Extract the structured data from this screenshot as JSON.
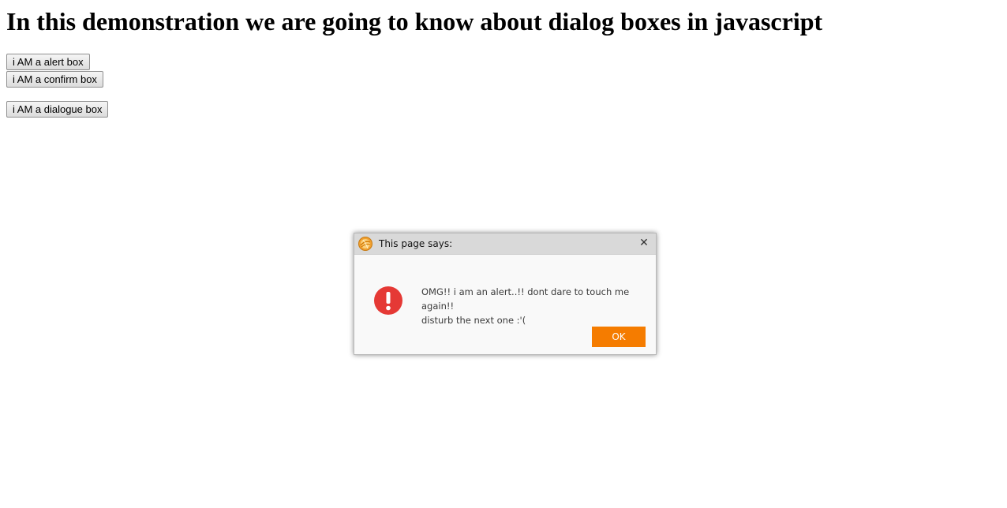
{
  "page": {
    "heading": "In this demonstration we are going to know about dialog boxes in javascript",
    "buttons": {
      "alert_label": "i AM a alert box",
      "confirm_label": "i AM a confirm box",
      "dialogue_label": "i AM a dialogue box"
    }
  },
  "dialog": {
    "title": "This page says:",
    "close_glyph": "✕",
    "app_icon": "browser-logo-icon",
    "status_icon": "error-exclamation-icon",
    "message_line1": "OMG!! i am an alert..!! dont dare to touch me again!!",
    "message_line2": "disturb the next one :'(",
    "ok_label": "OK",
    "colors": {
      "ok_button": "#f57c00",
      "error_icon": "#e53935",
      "titlebar": "#d9d9d9"
    }
  }
}
